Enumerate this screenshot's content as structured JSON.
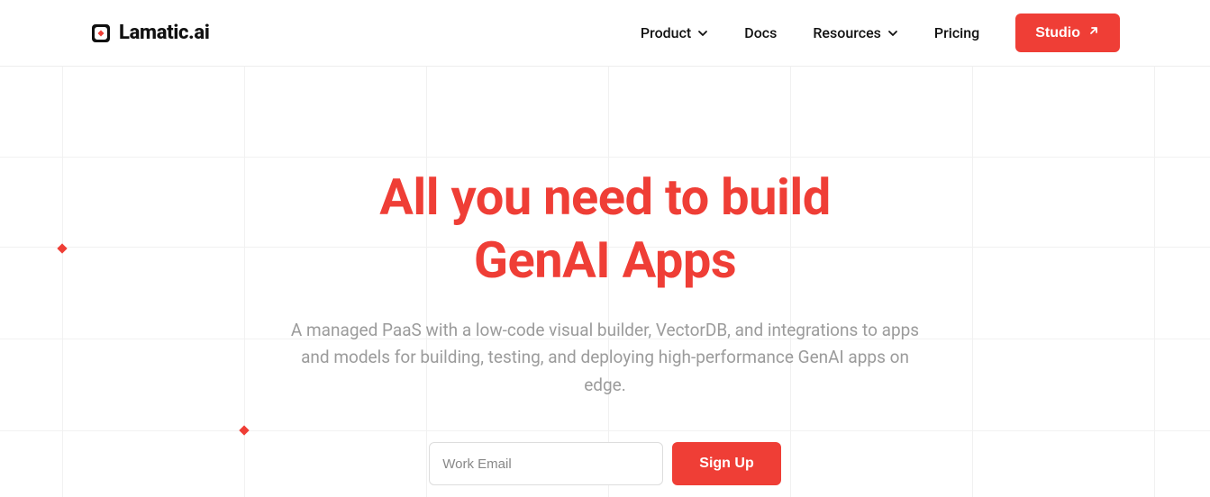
{
  "brand": {
    "name": "Lamatic.ai"
  },
  "nav": {
    "product": "Product",
    "docs": "Docs",
    "resources": "Resources",
    "pricing": "Pricing",
    "studio": "Studio"
  },
  "hero": {
    "title_line1": "All you need to build",
    "title_line2": "GenAI Apps",
    "subtitle": "A managed PaaS with a low-code visual builder, VectorDB, and integrations to apps and models for building, testing, and deploying high-performance GenAI apps on edge."
  },
  "signup": {
    "placeholder": "Work Email",
    "button": "Sign Up"
  },
  "colors": {
    "accent": "#ef3e36"
  }
}
